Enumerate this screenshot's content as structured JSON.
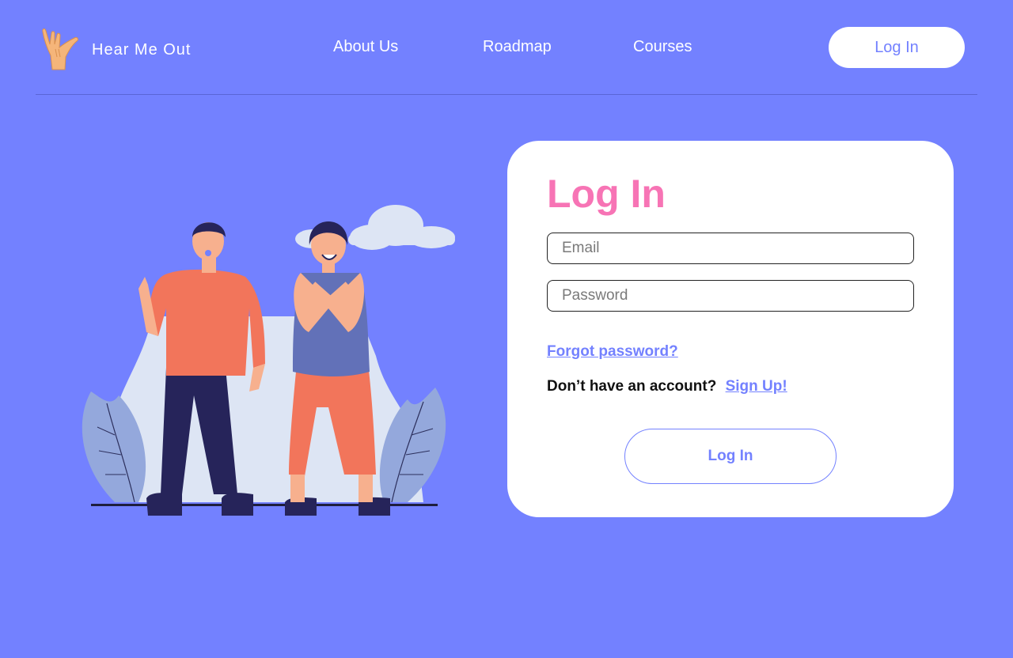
{
  "brand": {
    "name": "Hear Me Out",
    "logo_icon": "hand-sign-icon"
  },
  "nav": {
    "items": [
      {
        "label": "About Us"
      },
      {
        "label": "Roadmap"
      },
      {
        "label": "Courses"
      }
    ],
    "login_label": "Log In"
  },
  "login_form": {
    "title": "Log In",
    "email": {
      "placeholder": "Email",
      "value": ""
    },
    "password": {
      "placeholder": "Password",
      "value": ""
    },
    "forgot_label": "Forgot password?",
    "no_account_text": "Don’t have an account?",
    "signup_label": "Sign Up!",
    "submit_label": "Log In"
  },
  "colors": {
    "background": "#7381FF",
    "accent_pink": "#F774B5",
    "card": "#FFFFFF",
    "link": "#7381FF"
  }
}
